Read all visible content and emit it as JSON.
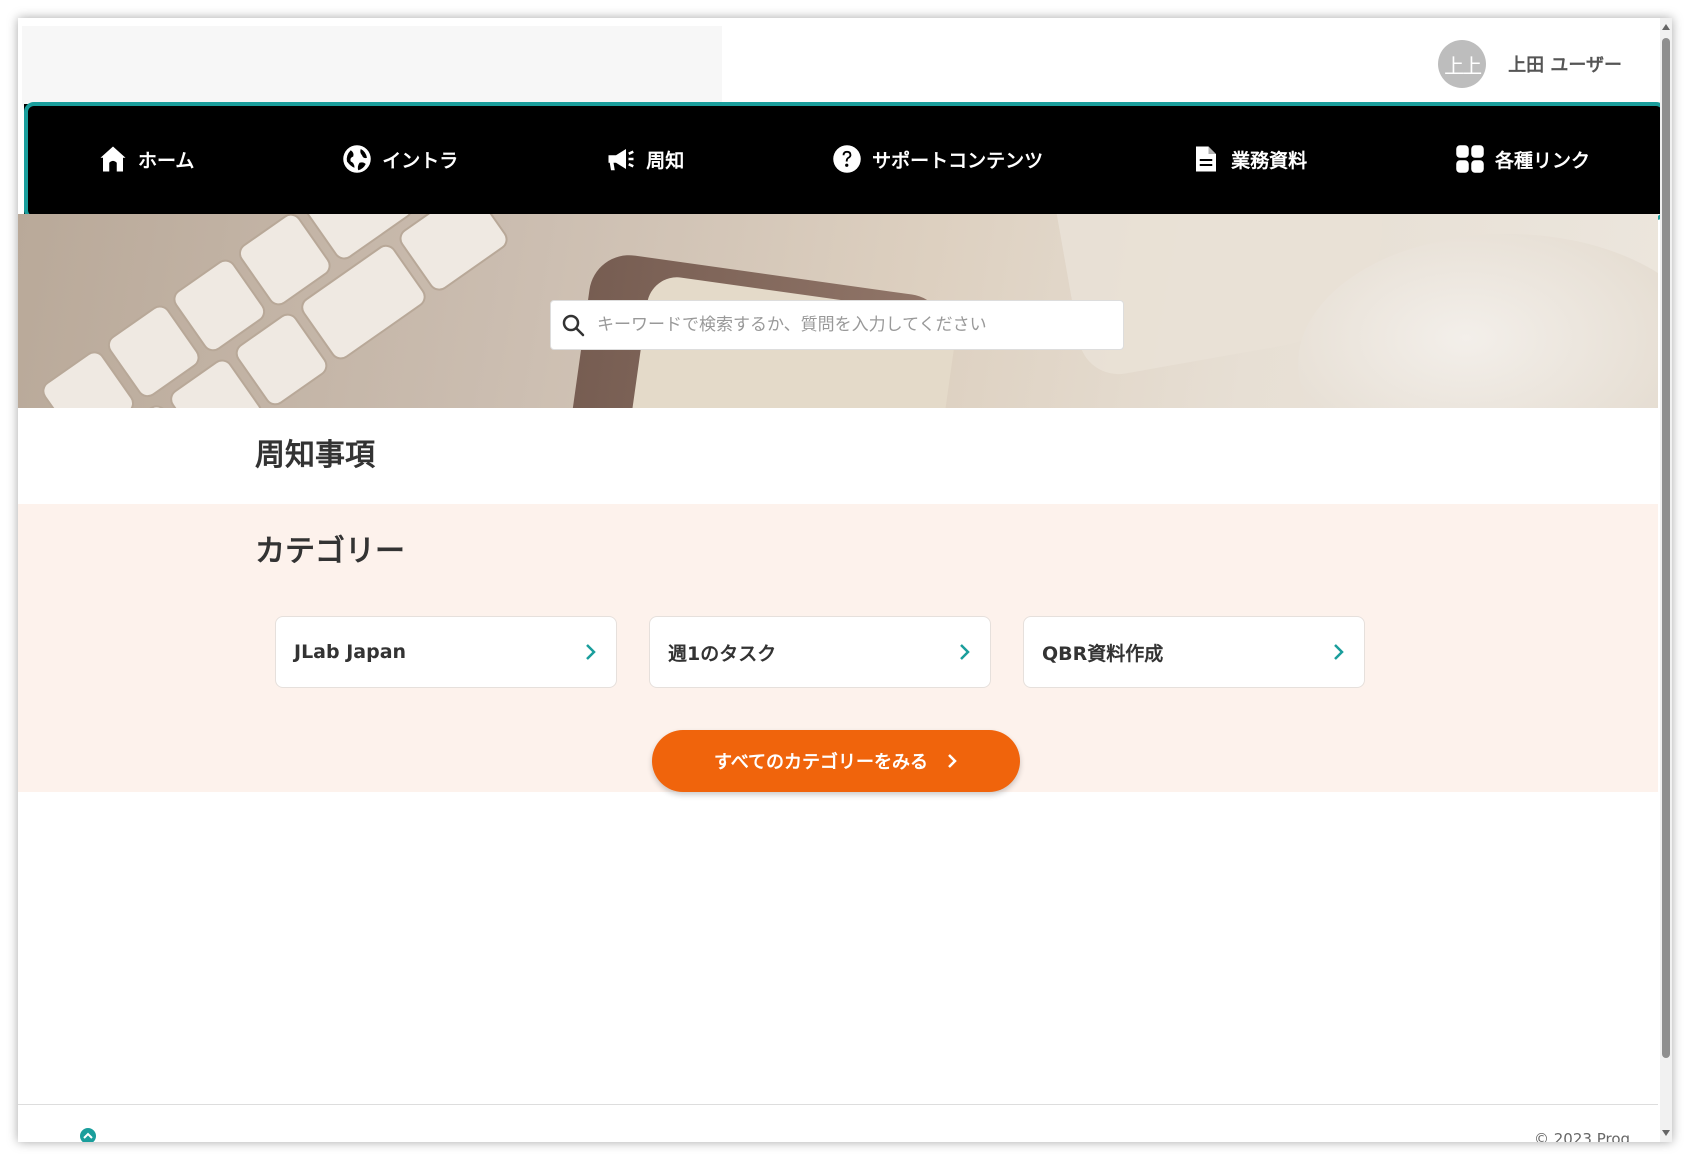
{
  "user": {
    "avatar_text": "上上",
    "name": "上田 ユーザー"
  },
  "nav": {
    "items": [
      {
        "label": "ホーム",
        "icon": "home-icon"
      },
      {
        "label": "イントラ",
        "icon": "globe-icon"
      },
      {
        "label": "周知",
        "icon": "megaphone-icon"
      },
      {
        "label": "サポートコンテンツ",
        "icon": "question-circle-icon"
      },
      {
        "label": "業務資料",
        "icon": "document-icon"
      },
      {
        "label": "各種リンク",
        "icon": "grid-icon"
      }
    ]
  },
  "search": {
    "placeholder": "キーワードで検索するか、質問を入力してください"
  },
  "notices": {
    "title": "周知事項"
  },
  "categories": {
    "title": "カテゴリー",
    "items": [
      {
        "label": "JLab Japan"
      },
      {
        "label": "週1のタスク"
      },
      {
        "label": "QBR資料作成"
      }
    ],
    "all_button_label": "すべてのカテゴリーをみる"
  },
  "footer": {
    "copyright": "© 2023 Prog"
  },
  "colors": {
    "accent": "#1a9e9c",
    "cta": "#f0640c",
    "nav_bg": "#000000",
    "category_bg": "#fdf2ec"
  }
}
